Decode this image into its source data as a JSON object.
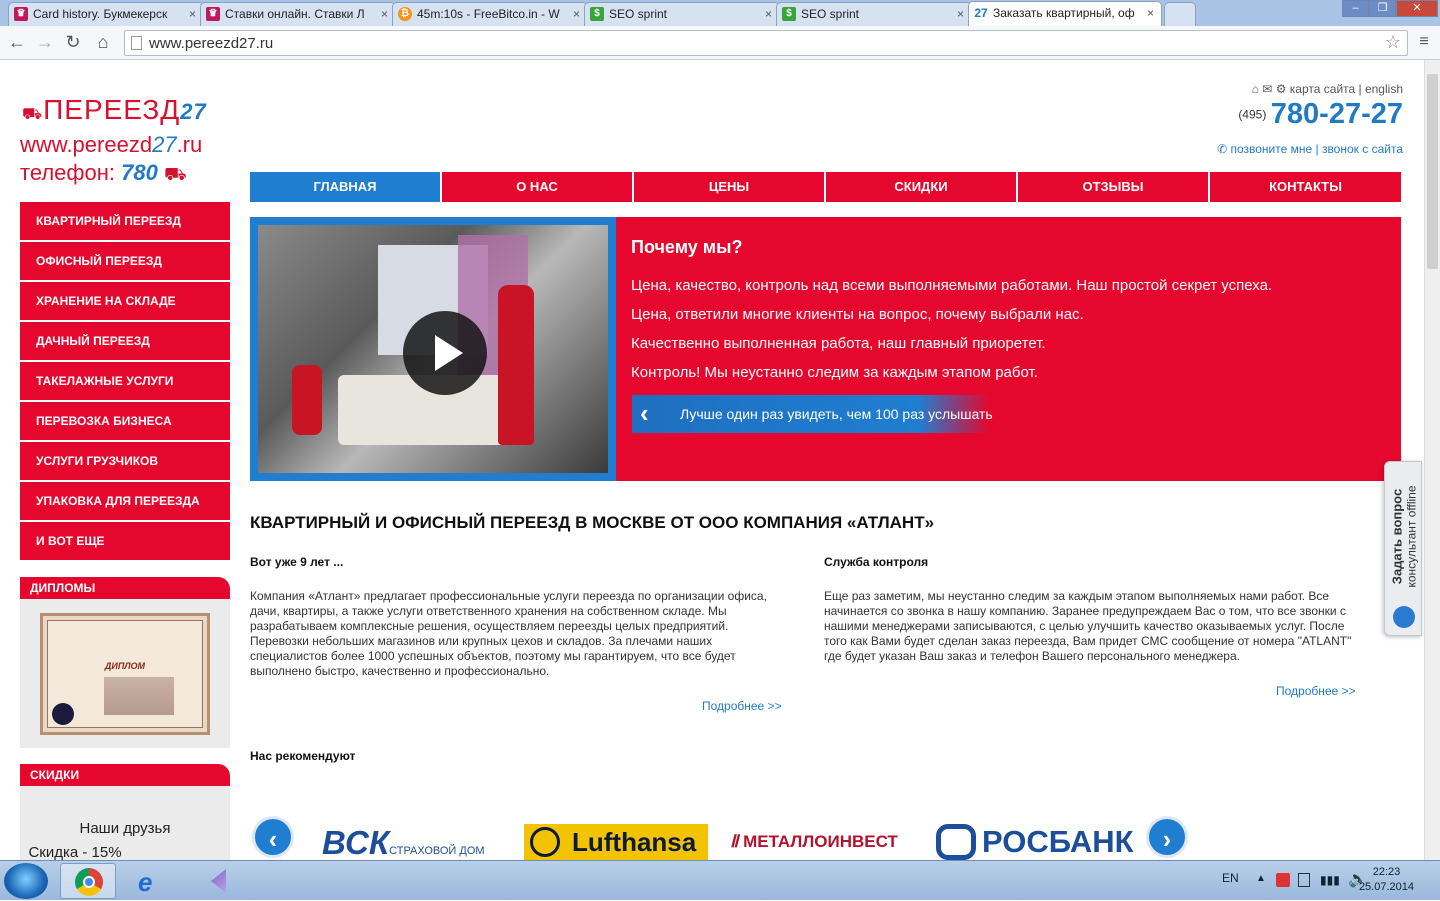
{
  "browser": {
    "tabs": [
      {
        "title": "Card history. Букмекерск",
        "icon_color": "#c2185b"
      },
      {
        "title": "Ставки онлайн. Ставки Л",
        "icon_color": "#c2185b"
      },
      {
        "title": "45m:10s - FreeBitco.in - W",
        "icon_color": "#f7931a"
      },
      {
        "title": "SEO sprint",
        "icon_color": "#3aa53a"
      },
      {
        "title": "SEO sprint",
        "icon_color": "#3aa53a"
      },
      {
        "title": "Заказать квартирный, оф",
        "icon_color": "#1f7bc3",
        "icon_text": "27"
      }
    ],
    "url": "www.pereezd27.ru"
  },
  "header": {
    "logo_line1": "ПЕРЕЕЗД",
    "logo_line1_num": "27",
    "logo_line2": "www.pereezd",
    "logo_line2_num": "27",
    "logo_line2_tail": ".ru",
    "logo_line3": "телефон: ",
    "logo_line3_num": "780",
    "top_links": "карта сайта | english",
    "phone_code": "(495)",
    "phone_number": "780-27-27",
    "call_links": "✆ позвоните мне | звонок с сайта"
  },
  "nav": [
    "ГЛАВНАЯ",
    "О НАС",
    "ЦЕНЫ",
    "СКИДКИ",
    "ОТЗЫВЫ",
    "КОНТАКТЫ"
  ],
  "sidebar": {
    "items": [
      "КВАРТИРНЫЙ ПЕРЕЕЗД",
      "ОФИСНЫЙ ПЕРЕЕЗД",
      "ХРАНЕНИЕ НА СКЛАДЕ",
      "ДАЧНЫЙ ПЕРЕЕЗД",
      "ТАКЕЛАЖНЫЕ УСЛУГИ",
      "ПЕРЕВОЗКА БИЗНЕСА",
      "УСЛУГИ ГРУЗЧИКОВ",
      "УПАКОВКА ДЛЯ ПЕРЕЕЗДА",
      "И ВОТ ЕЩЕ"
    ],
    "diplomas_title": "ДИПЛОМЫ",
    "diploma_text": "ДИПЛОМ",
    "discounts_title": "СКИДКИ",
    "discount_line1": "Наши друзья",
    "discount_line2": "Скидка - 15%"
  },
  "hero": {
    "title": "Почему мы?",
    "lines": [
      "Цена, качество, контроль над всеми выполняемыми работами. Наш простой секрет успеха.",
      "Цена, ответили многие клиенты на вопрос, почему выбрали нас.",
      "Качественно выполненная работа, наш главный приоретет.",
      "Контроль! Мы неустанно следим за каждым этапом работ."
    ],
    "button": "Лучше один раз увидеть, чем 100 раз услышать"
  },
  "main": {
    "heading": "КВАРТИРНЫЙ И ОФИСНЫЙ ПЕРЕЕЗД В МОСКВЕ ОТ ООО КОМПАНИЯ «АТЛАНТ»",
    "col1_title": "Вот уже 9 лет ...",
    "col1_text": "Компания «Атлант» предлагает профессиональные услуги переезда по организации офиса, дачи, квартиры, а также услуги ответственного хранения на собственном складе. Мы разрабатываем комплексные решения, осуществляем переезды целых предприятий. Перевозки небольших магазинов или крупных цехов и складов. За плечами наших специалистов более 1000 успешных объектов, поэтому мы гарантируем, что все будет выполнено быстро, качественно и профессионально.",
    "col2_title": "Служба контроля",
    "col2_text": "Еще раз заметим, мы неустанно следим за каждым этапом выполняемых нами работ. Все начинается со звонка в нашу компанию. Заранее предупреждаем Вас о том, что все звонки с нашими менеджерами записываются, с целью улучшить качество оказываемых услуг. После того как Вами будет сделан заказ переезда, Вам придет СМС сообщение от номера \"ATLANT\" где будет указан Ваш заказ и телефон Вашего персонального менеджера.",
    "more_label": "Подробнее >>",
    "recommend_title": "Нас рекомендуют",
    "brands": {
      "vsk": "ВСК",
      "vsk_sub": "СТРАХОВОЙ ДОМ",
      "lufthansa": "Lufthansa",
      "metall": "МЕТАЛЛОИНВЕСТ",
      "rosbank": "РОСБАНК"
    }
  },
  "widget": {
    "title": "Задать вопрос",
    "sub": "консультант offline"
  },
  "taskbar": {
    "lang": "EN",
    "time": "22:23",
    "date": "25.07.2014"
  }
}
